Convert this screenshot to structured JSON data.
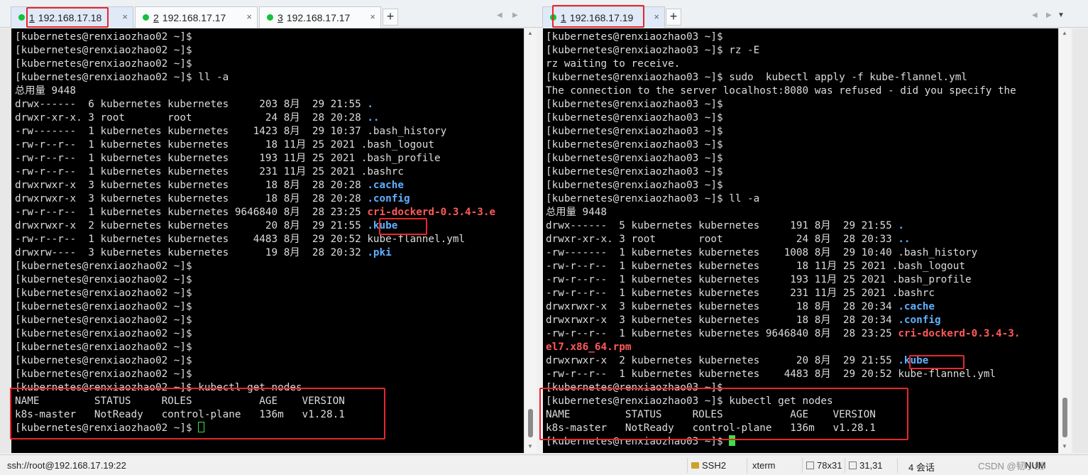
{
  "left": {
    "tabs": [
      {
        "num": "1",
        "label": "192.168.17.18",
        "active": true
      },
      {
        "num": "2",
        "label": "192.168.17.17",
        "active": false
      },
      {
        "num": "3",
        "label": "192.168.17.17",
        "active": false
      }
    ],
    "tab_close": "×",
    "tab_add": "+",
    "lines": [
      [
        {
          "t": "[kubernetes@renxiaozhao02 ~]$"
        }
      ],
      [
        {
          "t": "[kubernetes@renxiaozhao02 ~]$"
        }
      ],
      [
        {
          "t": "[kubernetes@renxiaozhao02 ~]$"
        }
      ],
      [
        {
          "t": "[kubernetes@renxiaozhao02 ~]$ ll -a"
        }
      ],
      [
        {
          "t": "总用量 9448"
        }
      ],
      [
        {
          "t": "drwx------  6 kubernetes kubernetes     203 8月  29 21:55 "
        },
        {
          "t": ".",
          "c": "blue"
        }
      ],
      [
        {
          "t": "drwxr-xr-x. 3 root       root            24 8月  28 20:28 "
        },
        {
          "t": "..",
          "c": "blue"
        }
      ],
      [
        {
          "t": "-rw-------  1 kubernetes kubernetes    1423 8月  29 10:37 .bash_history"
        }
      ],
      [
        {
          "t": "-rw-r--r--  1 kubernetes kubernetes      18 11月 25 2021 .bash_logout"
        }
      ],
      [
        {
          "t": "-rw-r--r--  1 kubernetes kubernetes     193 11月 25 2021 .bash_profile"
        }
      ],
      [
        {
          "t": "-rw-r--r--  1 kubernetes kubernetes     231 11月 25 2021 .bashrc"
        }
      ],
      [
        {
          "t": "drwxrwxr-x  3 kubernetes kubernetes      18 8月  28 20:28 "
        },
        {
          "t": ".cache",
          "c": "blue"
        }
      ],
      [
        {
          "t": "drwxrwxr-x  3 kubernetes kubernetes      18 8月  28 20:28 "
        },
        {
          "t": ".config",
          "c": "blue"
        }
      ],
      [
        {
          "t": "-rw-r--r--  1 kubernetes kubernetes 9646840 8月  28 23:25 "
        },
        {
          "t": "cri-dockerd-0.3.4-3.e",
          "c": "red"
        }
      ],
      [
        {
          "t": "drwxrwxr-x  2 kubernetes kubernetes      20 8月  29 21:55 "
        },
        {
          "t": ".kube",
          "c": "blue"
        }
      ],
      [
        {
          "t": "-rw-r--r--  1 kubernetes kubernetes    4483 8月  29 20:52 kube-flannel.yml"
        }
      ],
      [
        {
          "t": "drwxrw----  3 kubernetes kubernetes      19 8月  28 20:32 "
        },
        {
          "t": ".pki",
          "c": "blue"
        }
      ],
      [
        {
          "t": "[kubernetes@renxiaozhao02 ~]$"
        }
      ],
      [
        {
          "t": "[kubernetes@renxiaozhao02 ~]$"
        }
      ],
      [
        {
          "t": "[kubernetes@renxiaozhao02 ~]$"
        }
      ],
      [
        {
          "t": "[kubernetes@renxiaozhao02 ~]$"
        }
      ],
      [
        {
          "t": "[kubernetes@renxiaozhao02 ~]$"
        }
      ],
      [
        {
          "t": "[kubernetes@renxiaozhao02 ~]$"
        }
      ],
      [
        {
          "t": "[kubernetes@renxiaozhao02 ~]$"
        }
      ],
      [
        {
          "t": "[kubernetes@renxiaozhao02 ~]$"
        }
      ],
      [
        {
          "t": "[kubernetes@renxiaozhao02 ~]$"
        }
      ],
      [
        {
          "t": "[kubernetes@renxiaozhao02 ~]$ kubectl get nodes"
        }
      ],
      [
        {
          "t": "NAME         STATUS     ROLES           AGE    VERSION"
        }
      ],
      [
        {
          "t": "k8s-master   NotReady   control-plane   136m   v1.28.1"
        }
      ],
      [
        {
          "t": "[kubernetes@renxiaozhao02 ~]$ "
        },
        {
          "cursor": "box"
        }
      ]
    ]
  },
  "right": {
    "tabs": [
      {
        "num": "1",
        "label": "192.168.17.19",
        "active": true
      }
    ],
    "tab_close": "×",
    "tab_add": "+",
    "lines": [
      [
        {
          "t": "[kubernetes@renxiaozhao03 ~]$"
        }
      ],
      [
        {
          "t": "[kubernetes@renxiaozhao03 ~]$ rz -E"
        }
      ],
      [
        {
          "t": "rz waiting to receive."
        }
      ],
      [
        {
          "t": "[kubernetes@renxiaozhao03 ~]$ sudo  kubectl apply -f kube-flannel.yml"
        }
      ],
      [
        {
          "t": "The connection to the server localhost:8080 was refused - did you specify the"
        }
      ],
      [
        {
          "t": "[kubernetes@renxiaozhao03 ~]$"
        }
      ],
      [
        {
          "t": "[kubernetes@renxiaozhao03 ~]$"
        }
      ],
      [
        {
          "t": "[kubernetes@renxiaozhao03 ~]$"
        }
      ],
      [
        {
          "t": "[kubernetes@renxiaozhao03 ~]$"
        }
      ],
      [
        {
          "t": "[kubernetes@renxiaozhao03 ~]$"
        }
      ],
      [
        {
          "t": "[kubernetes@renxiaozhao03 ~]$"
        }
      ],
      [
        {
          "t": "[kubernetes@renxiaozhao03 ~]$"
        }
      ],
      [
        {
          "t": "[kubernetes@renxiaozhao03 ~]$ ll -a"
        }
      ],
      [
        {
          "t": "总用量 9448"
        }
      ],
      [
        {
          "t": "drwx------  5 kubernetes kubernetes     191 8月  29 21:55 "
        },
        {
          "t": ".",
          "c": "blue"
        }
      ],
      [
        {
          "t": "drwxr-xr-x. 3 root       root            24 8月  28 20:33 "
        },
        {
          "t": "..",
          "c": "blue"
        }
      ],
      [
        {
          "t": "-rw-------  1 kubernetes kubernetes    1008 8月  29 10:40 .bash_history"
        }
      ],
      [
        {
          "t": "-rw-r--r--  1 kubernetes kubernetes      18 11月 25 2021 .bash_logout"
        }
      ],
      [
        {
          "t": "-rw-r--r--  1 kubernetes kubernetes     193 11月 25 2021 .bash_profile"
        }
      ],
      [
        {
          "t": "-rw-r--r--  1 kubernetes kubernetes     231 11月 25 2021 .bashrc"
        }
      ],
      [
        {
          "t": "drwxrwxr-x  3 kubernetes kubernetes      18 8月  28 20:34 "
        },
        {
          "t": ".cache",
          "c": "blue"
        }
      ],
      [
        {
          "t": "drwxrwxr-x  3 kubernetes kubernetes      18 8月  28 20:34 "
        },
        {
          "t": ".config",
          "c": "blue"
        }
      ],
      [
        {
          "t": "-rw-r--r--  1 kubernetes kubernetes 9646840 8月  28 23:25 "
        },
        {
          "t": "cri-dockerd-0.3.4-3.",
          "c": "red"
        }
      ],
      [
        {
          "t": "el7.x86_64.rpm",
          "c": "red"
        }
      ],
      [
        {
          "t": "drwxrwxr-x  2 kubernetes kubernetes      20 8月  29 21:55 "
        },
        {
          "t": ".kube",
          "c": "blue"
        }
      ],
      [
        {
          "t": "-rw-r--r--  1 kubernetes kubernetes    4483 8月  29 20:52 kube-flannel.yml"
        }
      ],
      [
        {
          "t": "[kubernetes@renxiaozhao03 ~]$"
        }
      ],
      [
        {
          "t": "[kubernetes@renxiaozhao03 ~]$ kubectl get nodes"
        }
      ],
      [
        {
          "t": "NAME         STATUS     ROLES           AGE    VERSION"
        }
      ],
      [
        {
          "t": "k8s-master   NotReady   control-plane   136m   v1.28.1"
        }
      ],
      [
        {
          "t": "[kubernetes@renxiaozhao03 ~]$ "
        },
        {
          "cursor": "solid"
        }
      ]
    ]
  },
  "statusbar": {
    "connection": "ssh://root@192.168.17.19:22",
    "protocol": "SSH2",
    "terminal_type": "xterm",
    "size": "78x31",
    "cursor_pos": "31,31",
    "sessions": "4 会话",
    "watermark": "CSDN @韧小侧",
    "num_lock": "NUM"
  },
  "colors": {
    "terminal_bg": "#000000",
    "terminal_fg": "#dcdcdc",
    "dir_blue": "#5fb0ff",
    "archive_red": "#ff5a5a",
    "highlight_box": "#e8262c",
    "cursor_green": "#3de04a"
  }
}
